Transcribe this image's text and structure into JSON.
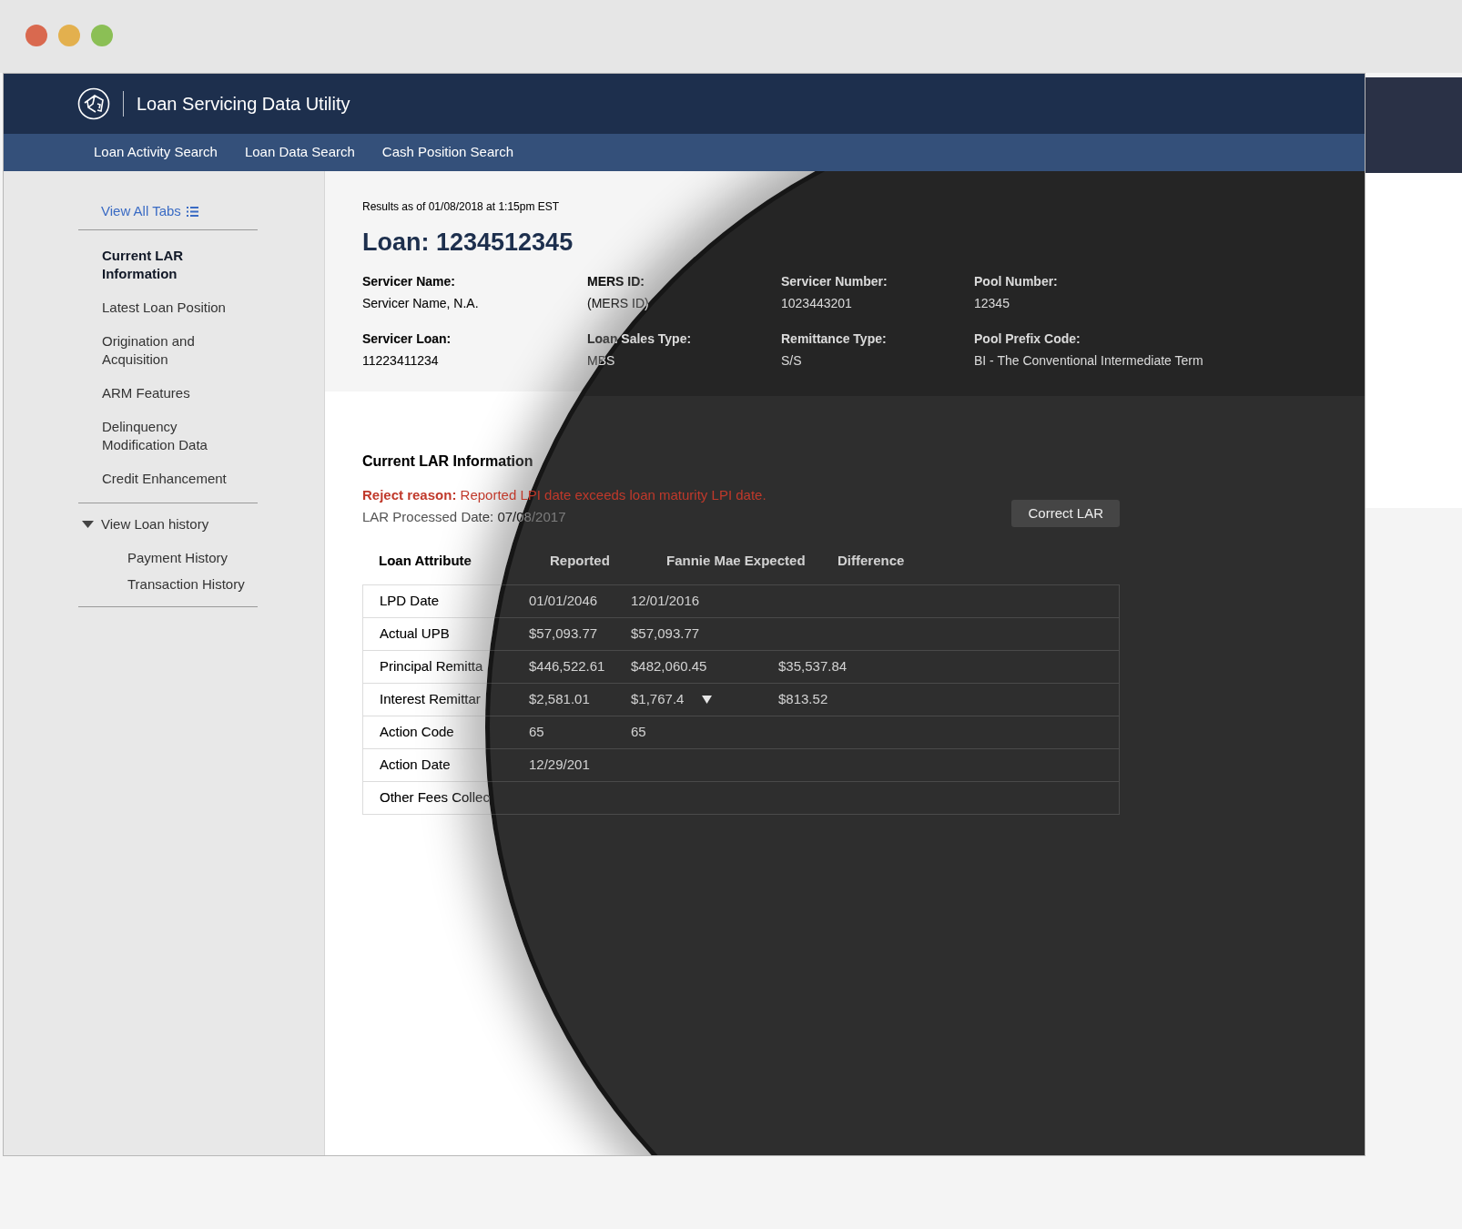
{
  "app": {
    "title": "Loan Servicing Data Utility"
  },
  "nav": [
    {
      "label": "Loan Activity Search"
    },
    {
      "label": "Loan Data Search"
    },
    {
      "label": "Cash Position Search"
    }
  ],
  "sidebar": {
    "view_all": "View All Tabs",
    "sections": [
      {
        "label": "Current LAR Information",
        "selected": true
      },
      {
        "label": "Latest Loan Position",
        "selected": false
      },
      {
        "label": "Origination and Acquisition",
        "selected": false
      },
      {
        "label": "ARM Features",
        "selected": false
      },
      {
        "label": "Delinquency Modification Data",
        "selected": false
      },
      {
        "label": "Credit Enhancement",
        "selected": false
      }
    ],
    "history": {
      "label": "View Loan history",
      "expanded": true,
      "children": [
        {
          "label": "Payment History"
        },
        {
          "label": "Transaction History"
        }
      ]
    }
  },
  "results_as_of": "Results as of 01/08/2018 at 1:15pm EST",
  "loan_title": "Loan: 1234512345",
  "fields": [
    {
      "label": "Servicer Name:",
      "value": "Servicer Name, N.A."
    },
    {
      "label": "MERS ID:",
      "value": "(MERS ID)"
    },
    {
      "label": "Servicer Number:",
      "value": "1023443201"
    },
    {
      "label": "Pool Number:",
      "value": "12345"
    },
    {
      "label": "Servicer Loan:",
      "value": "11223411234"
    },
    {
      "label": "Loan Sales Type:",
      "value": "MBS"
    },
    {
      "label": "Remittance Type:",
      "value": "S/S"
    },
    {
      "label": "Pool Prefix Code:",
      "value": "BI - The Conventional Intermediate Term"
    }
  ],
  "lar": {
    "title": "Current LAR Information",
    "reject": "**Reject reason:** Reported LPI date exceeds loan maturity LPI date.",
    "processed": "LAR Processed Date: 07/08/2017",
    "button": "Correct LAR"
  },
  "table": {
    "columns": [
      "Loan Attribute",
      "Reported",
      "Fannie Mae Expected",
      "Difference"
    ],
    "rows": [
      {
        "attribute": "LPD Date",
        "reported": "01/01/2046",
        "expected": "12/01/2016",
        "has_dropdown": false
      },
      {
        "attribute": "Actual UPB",
        "reported": "$57,093.77",
        "expected": "$57,093.77",
        "has_dropdown": false
      },
      {
        "attribute": "Principal Remitta",
        "reported": "$446,522.61",
        "expected": "$482,060.45",
        "difference": "$35,537.84",
        "has_dropdown": false
      },
      {
        "attribute": "Interest Remittar",
        "reported": "$2,581.01",
        "expected": "$1,767.4",
        "difference": "$813.52",
        "has_dropdown": true
      },
      {
        "attribute": "Action Code",
        "reported": "65",
        "expected": "65",
        "has_dropdown": false
      },
      {
        "attribute": "Action Date",
        "reported": "12/29/201",
        "has_dropdown": false
      },
      {
        "attribute": "Other Fees Collec",
        "has_dropdown": false
      }
    ]
  }
}
